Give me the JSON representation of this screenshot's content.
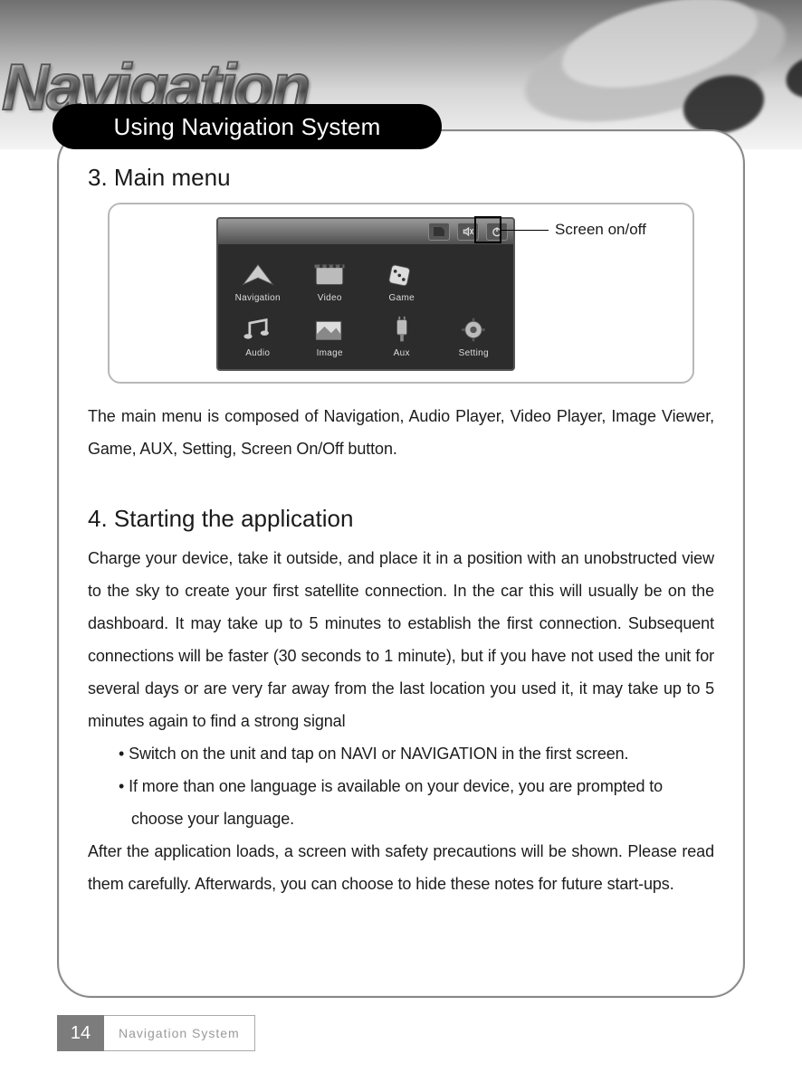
{
  "header": {
    "brand_title": "Navigation"
  },
  "section_tab": "Using Navigation System",
  "sec3": {
    "heading": "3. Main menu",
    "callout": "Screen on/off",
    "device": {
      "row1": [
        "Navigation",
        "Video",
        "Game"
      ],
      "row2": [
        "Audio",
        "Image",
        "Aux",
        "Setting"
      ]
    },
    "caption": "The main menu is composed of Navigation, Audio Player, Video Player, Image Viewer, Game, AUX, Setting, Screen On/Off button."
  },
  "sec4": {
    "heading": "4. Starting the application",
    "intro": "Charge your device, take it outside, and place it in a position with an unobstructed view to the sky to create your first satellite connection. In the car this will usually be on the dashboard. It may take up to 5 minutes to establish the first connection. Subsequent connections will be faster (30 seconds to 1 minute), but if you have not used the unit for several days or are very far away from the last location you used it, it may take up to 5 minutes again to find a strong signal",
    "bullets": [
      "• Switch on the unit and tap on NAVI or NAVIGATION in the first screen.",
      "• If more than one language is available on your device, you are prompted to choose your language."
    ],
    "outro": "After the application loads, a screen with safety precautions will be shown. Please read them carefully. Afterwards, you can choose to hide these notes for future start-ups."
  },
  "footer": {
    "page_no": "14",
    "label": "Navigation System"
  }
}
